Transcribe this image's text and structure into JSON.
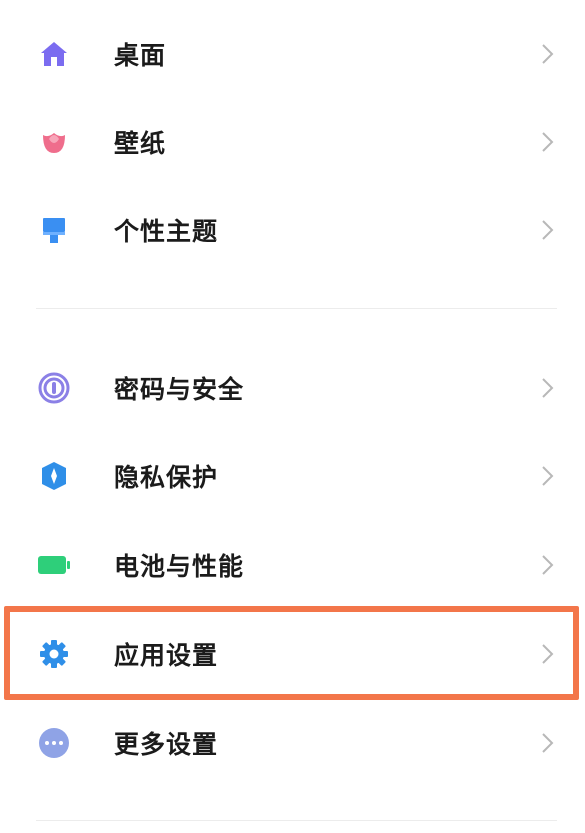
{
  "settings": {
    "items": [
      {
        "label": "桌面",
        "icon": "home-icon",
        "color": "#7b6cf0"
      },
      {
        "label": "壁纸",
        "icon": "tulip-icon",
        "color": "#ef6d8c"
      },
      {
        "label": "个性主题",
        "icon": "paint-brush-icon",
        "color": "#3a8ff2"
      },
      {
        "label": "密码与安全",
        "icon": "fingerprint-icon",
        "color": "#8b80e6"
      },
      {
        "label": "隐私保护",
        "icon": "privacy-shield-icon",
        "color": "#2f8fe8"
      },
      {
        "label": "电池与性能",
        "icon": "battery-icon",
        "color": "#2ecf7a"
      },
      {
        "label": "应用设置",
        "icon": "gear-icon",
        "color": "#2f8fe8",
        "highlighted": true
      },
      {
        "label": "更多设置",
        "icon": "more-dots-icon",
        "color": "#8fa3e6"
      }
    ]
  },
  "highlight_color": "#f3764a"
}
